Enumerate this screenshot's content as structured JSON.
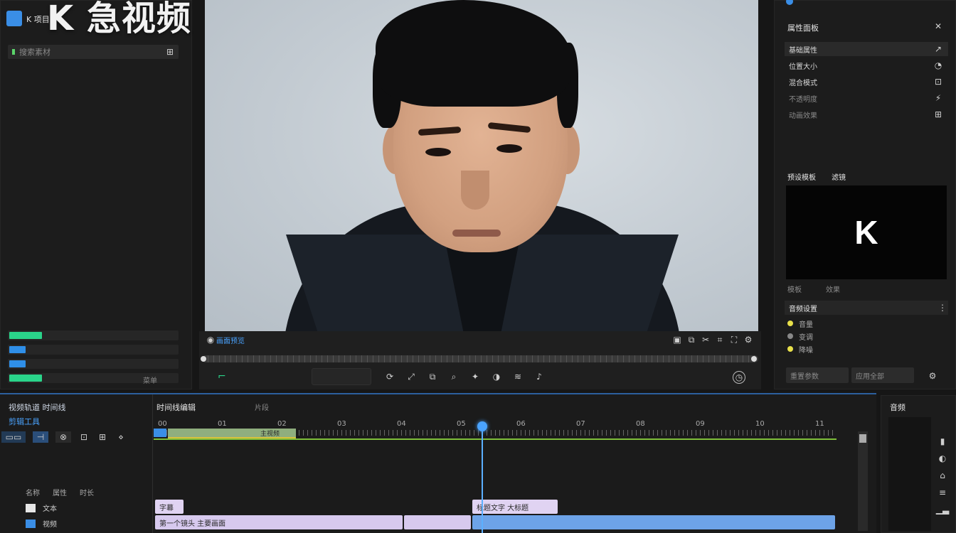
{
  "app": {
    "logo_label": "K",
    "title": "K 急视频"
  },
  "left_panel": {
    "header": "K 项目",
    "search_label": "搜索素材",
    "meters": [
      {
        "color": "#2ad48a",
        "fill": 0.2
      },
      {
        "color": "#2f8fe8",
        "fill": 0.1
      },
      {
        "color": "#2f8fe8",
        "fill": 0.1
      },
      {
        "color": "#2ad48a",
        "fill": 0.2
      }
    ],
    "meter_action": "菜单"
  },
  "preview": {
    "bottom_label": "画面预览",
    "controls": [
      "裁剪",
      "旋转",
      "翻转",
      "缩放",
      "特效",
      "调色",
      "变速",
      "音频"
    ],
    "green_icon": "frame-icon",
    "clock_icon": "clock-icon"
  },
  "right_panel": {
    "header": "属性面板",
    "items": [
      "基础属性",
      "位置大小",
      "混合模式",
      "不透明度",
      "动画效果"
    ],
    "preview_header": "预设模板",
    "preview_header2": "滤镜",
    "preview_letter": "K",
    "preview_caption": "模板",
    "preview_caption2": "效果",
    "section2_header": "音频设置",
    "options": [
      {
        "label": "音量",
        "color": "#e8e04a"
      },
      {
        "label": "变调",
        "color": "#888888"
      },
      {
        "label": "降噪",
        "color": "#e8e04a"
      }
    ],
    "btn1": "重置参数",
    "btn2": "应用全部"
  },
  "timeline": {
    "header_left": "视频轨道 时间线",
    "header_mid": "时间线编辑",
    "header_mid2": "片段",
    "tool_label": "剪辑工具",
    "ruler": [
      "00",
      "01",
      "02",
      "03",
      "04",
      "05",
      "06",
      "07",
      "08",
      "09",
      "10",
      "11"
    ],
    "track_headers": [
      "名称",
      "属性",
      "时长"
    ],
    "tracks": [
      {
        "name": "文本",
        "clips": [
          {
            "label": "字幕",
            "color": "#e0d3f2"
          },
          {
            "label": "标题文字 大标题",
            "color": "#e0d3f2"
          }
        ]
      },
      {
        "name": "视频",
        "clips": [
          {
            "label": "第一个镜头 主要画面",
            "color": "#d7c9ee"
          },
          {
            "label": "",
            "color": "#d7c9ee"
          },
          {
            "label": "",
            "color": "#6da3e8"
          }
        ]
      }
    ],
    "green_clip_label": "主视频"
  },
  "far_right": {
    "header": "音频"
  }
}
